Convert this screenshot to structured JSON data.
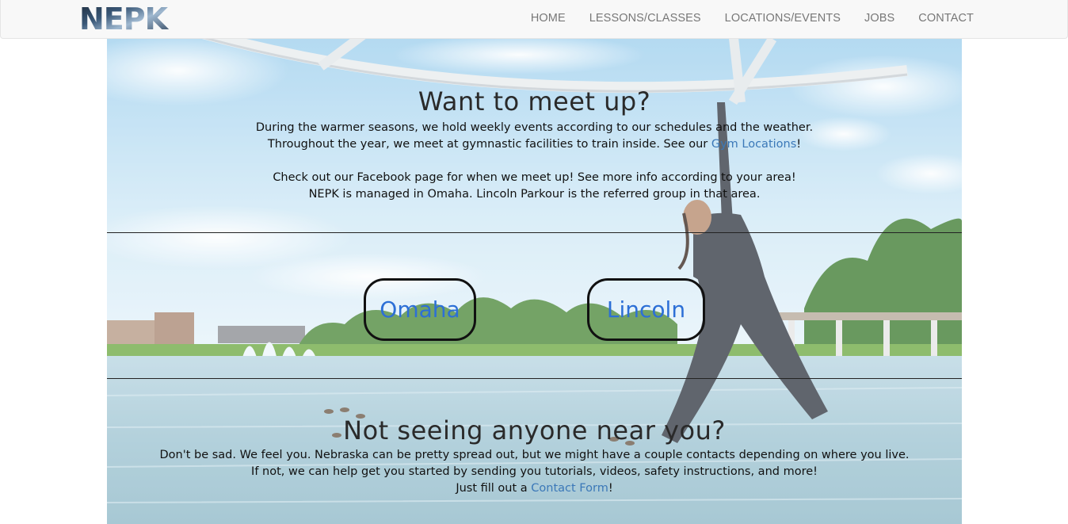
{
  "nav": {
    "logo_text": "NEPK",
    "links": [
      "HOME",
      "LESSONS/CLASSES",
      "LOCATIONS/EVENTS",
      "JOBS",
      "CONTACT"
    ]
  },
  "meetup": {
    "title": "Want to meet up?",
    "line1": "During the warmer seasons, we hold weekly events according to our schedules and the weather.",
    "line2_before": "Throughout the year, we meet at gymnastic facilities to train inside. See our ",
    "line2_link": "Gym Locations",
    "line2_after": "!",
    "line3": "Check out our Facebook page for when we meet up! See more info according to your area!",
    "line4": "NEPK is managed in Omaha. Lincoln Parkour is the referred group in that area."
  },
  "cities": {
    "omaha": "Omaha",
    "lincoln": "Lincoln"
  },
  "nobody": {
    "title": "Not seeing anyone near you?",
    "line1": "Don't be sad. We feel you. Nebraska can be pretty spread out, but we might have a couple contacts depending on where you live.",
    "line2": "If not, we can help get you started by sending you tutorials, videos, safety instructions, and more!",
    "line3_before": "Just fill out a ",
    "line3_link": "Contact Form",
    "line3_after": "!"
  },
  "colors": {
    "link": "#3b78b8",
    "city_link": "#2d6fd6",
    "nav_text": "#777777",
    "navbar_bg": "#f8f8f8"
  }
}
